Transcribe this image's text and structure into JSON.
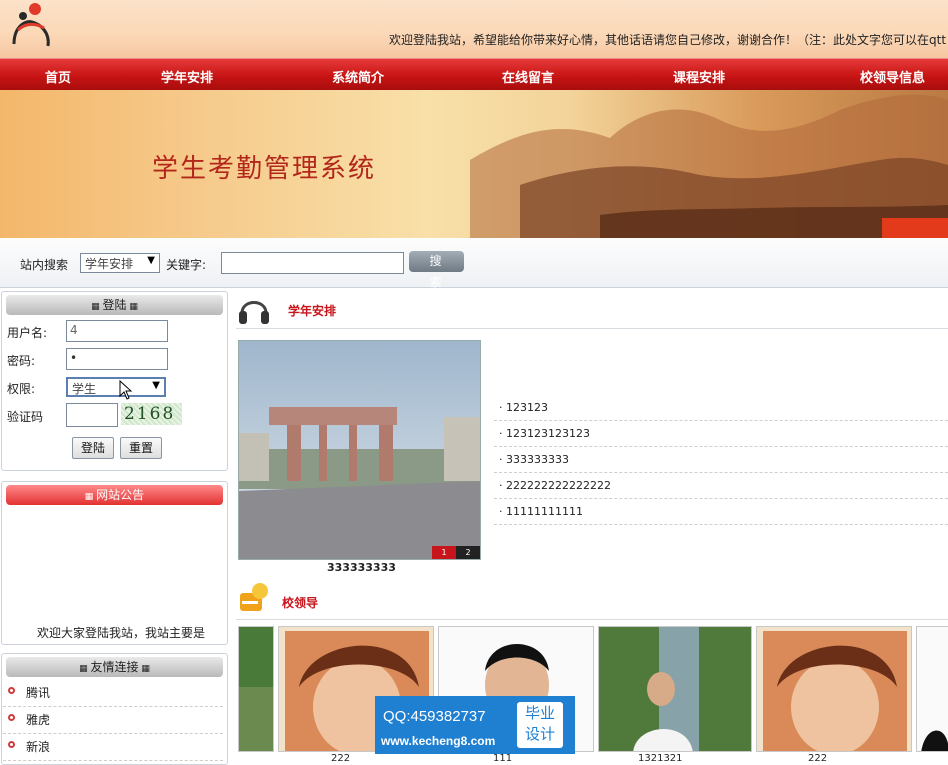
{
  "header": {
    "marquee": "欢迎登陆我站，希望能给你带来好心情，其他话语请您自己修改，谢谢合作！（注：此处文字您可以在qtt"
  },
  "nav": {
    "items": [
      "首页",
      "学年安排",
      "系统简介",
      "在线留言",
      "课程安排",
      "校领导信息"
    ]
  },
  "banner": {
    "title": "学生考勤管理系统"
  },
  "search": {
    "label": "站内搜索",
    "category": "学年安排",
    "keyword_label": "关键字:",
    "keyword_value": "",
    "button": "搜 索"
  },
  "login": {
    "title": "登陆",
    "username_label": "用户名:",
    "username_value": "4",
    "password_label": "密码:",
    "password_value": "•",
    "role_label": "权限:",
    "role_value": "学生",
    "captcha_label": "验证码",
    "captcha_value": "",
    "captcha_image": "2168",
    "login_button": "登陆",
    "reset_button": "重置"
  },
  "announcement": {
    "title": "网站公告",
    "text": "欢迎大家登陆我站，我站主要是"
  },
  "links": {
    "title": "友情连接",
    "items": [
      "腾讯",
      "雅虎",
      "新浪"
    ]
  },
  "schedule": {
    "title": "学年安排",
    "slide_caption": "333333333",
    "slide_pages": [
      "1",
      "2"
    ],
    "items": [
      "· 123123",
      "· 123123123123",
      "· 333333333",
      "· 222222222222222",
      "· 11111111111"
    ]
  },
  "leaders": {
    "title": "校领导",
    "captions": [
      "222",
      "111",
      "1321321",
      "222"
    ]
  },
  "watermark": {
    "qq": "QQ:459382737",
    "site": "www.kecheng8.com",
    "tag1": "毕业",
    "tag2": "设计"
  },
  "colors": {
    "nav_red": "#c81414",
    "title_red": "#c8151b",
    "accent_blue": "#1f7fd1"
  }
}
